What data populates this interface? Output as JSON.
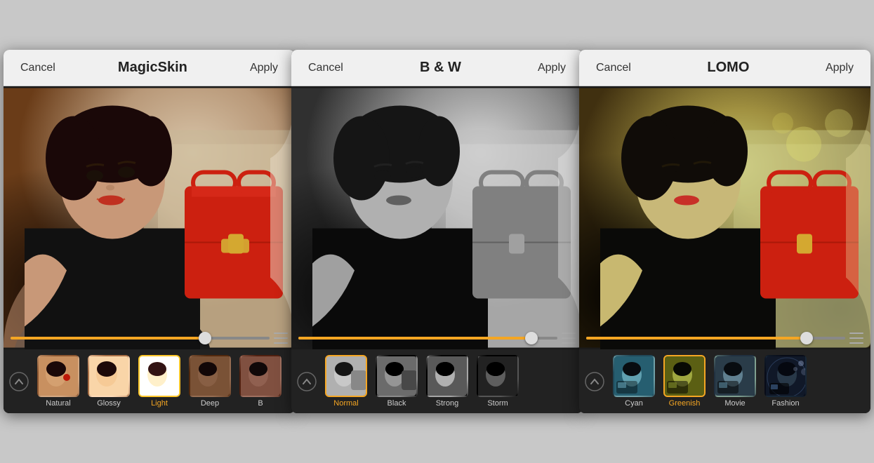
{
  "panels": [
    {
      "id": "magicskin",
      "title": "MagicSkin",
      "cancel_label": "Cancel",
      "apply_label": "Apply",
      "slider_value": 75,
      "filters": [
        {
          "id": "natural",
          "label": "Natural",
          "active": false,
          "thumb_class": "thumb-natural"
        },
        {
          "id": "glossy",
          "label": "Glossy",
          "active": false,
          "thumb_class": "thumb-glossy"
        },
        {
          "id": "light",
          "label": "Light",
          "active": true,
          "thumb_class": "thumb-light"
        },
        {
          "id": "deep",
          "label": "Deep",
          "active": false,
          "thumb_class": "thumb-deep"
        },
        {
          "id": "b",
          "label": "B",
          "active": false,
          "thumb_class": "thumb-b"
        }
      ]
    },
    {
      "id": "bw",
      "title": "B & W",
      "cancel_label": "Cancel",
      "apply_label": "Apply",
      "slider_value": 90,
      "filters": [
        {
          "id": "normal",
          "label": "Normal",
          "active": true,
          "thumb_class": "thumb-normal-bw"
        },
        {
          "id": "black",
          "label": "Black",
          "active": false,
          "thumb_class": "thumb-black"
        },
        {
          "id": "strong",
          "label": "Strong",
          "active": false,
          "thumb_class": "thumb-strong"
        },
        {
          "id": "storm",
          "label": "Storm",
          "active": false,
          "thumb_class": "thumb-storm"
        }
      ]
    },
    {
      "id": "lomo",
      "title": "LOMO",
      "cancel_label": "Cancel",
      "apply_label": "Apply",
      "slider_value": 85,
      "filters": [
        {
          "id": "cyan",
          "label": "Cyan",
          "active": false,
          "thumb_class": "thumb-cyan"
        },
        {
          "id": "greenish",
          "label": "Greenish",
          "active": true,
          "thumb_class": "thumb-greenish"
        },
        {
          "id": "movie",
          "label": "Movie",
          "active": false,
          "thumb_class": "thumb-movie"
        },
        {
          "id": "fashion",
          "label": "Fashion",
          "active": false,
          "thumb_class": "thumb-fashion"
        }
      ]
    }
  ],
  "icons": {
    "arrow_up": "⌃",
    "menu_lines": "≡"
  }
}
